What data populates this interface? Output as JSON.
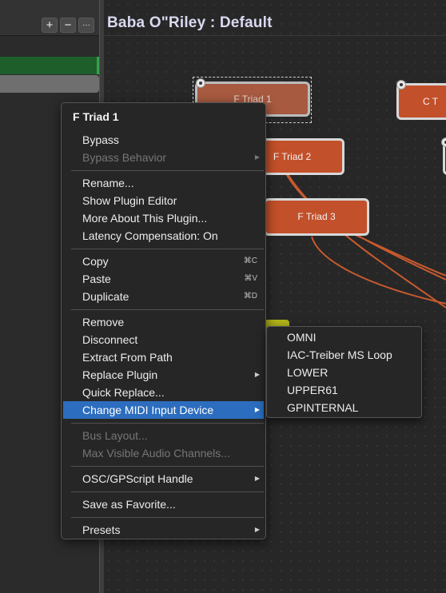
{
  "left_panel": {
    "add_button": "+",
    "remove_button": "−",
    "more_button": "···"
  },
  "rackspace": {
    "title": "Baba O\"Riley : Default"
  },
  "plugins": {
    "f_triad_1": "F Triad 1",
    "f_triad_2": "F Triad 2",
    "f_triad_3": "F Triad 3",
    "c_triad": "C T"
  },
  "context_menu": {
    "header": "F Triad 1",
    "items": {
      "bypass": "Bypass",
      "bypass_behavior": "Bypass Behavior",
      "rename": "Rename...",
      "show_plugin_editor": "Show Plugin Editor",
      "more_about": "More About This Plugin...",
      "latency_compensation": "Latency Compensation: On",
      "copy": "Copy",
      "copy_shortcut": "⌘C",
      "paste": "Paste",
      "paste_shortcut": "⌘V",
      "duplicate": "Duplicate",
      "duplicate_shortcut": "⌘D",
      "remove": "Remove",
      "disconnect": "Disconnect",
      "extract_from_path": "Extract From Path",
      "replace_plugin": "Replace Plugin",
      "quick_replace": "Quick Replace...",
      "change_midi_input": "Change MIDI Input Device",
      "bus_layout": "Bus Layout...",
      "max_visible_audio": "Max Visible Audio Channels...",
      "osc_handle": "OSC/GPScript Handle",
      "save_favorite": "Save as Favorite...",
      "presets": "Presets"
    },
    "submenu_arrow": "▶"
  },
  "midi_submenu": {
    "items": [
      "OMNI",
      "IAC-Treiber MS Loop",
      "LOWER",
      "UPPER61",
      "GPINTERNAL"
    ]
  },
  "colors": {
    "plugin_orange": "#c2502a",
    "highlight_blue": "#2c6dbf",
    "wire_orange": "#c95a2e",
    "green_track": "#1d5e2b"
  }
}
